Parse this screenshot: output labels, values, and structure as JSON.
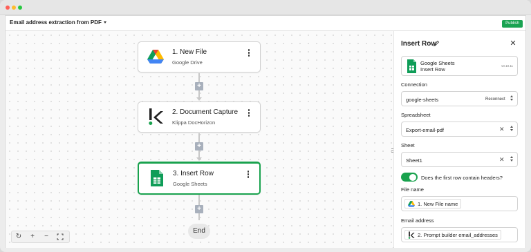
{
  "window": {
    "controls": [
      "close",
      "minimize",
      "maximize"
    ]
  },
  "header": {
    "flow_title": "Email address extraction from PDF",
    "publish_label": "Publish"
  },
  "nodes": [
    {
      "title": "1. New File",
      "subtitle": "Google Drive",
      "icon": "google-drive-icon"
    },
    {
      "title": "2. Document Capture",
      "subtitle": "Klippa DocHorizon",
      "icon": "klippa-icon"
    },
    {
      "title": "3. Insert Row",
      "subtitle": "Google Sheets",
      "icon": "google-sheets-icon",
      "selected": true
    }
  ],
  "end_label": "End",
  "zoom_controls": [
    "refresh",
    "zoom-in",
    "zoom-out",
    "fit-view"
  ],
  "panel": {
    "title": "Insert Row",
    "app_card": {
      "app": "Google Sheets",
      "action": "Insert Row",
      "version": "v0.10.11"
    },
    "connection": {
      "label": "Connection",
      "value": "google-sheets",
      "reconnect": "Reconnect"
    },
    "spreadsheet": {
      "label": "Spreadsheet",
      "value": "Export-email-pdf"
    },
    "sheet": {
      "label": "Sheet",
      "value": "Sheet1"
    },
    "headers_toggle": {
      "label": "Does the first row contain headers?",
      "on": true
    },
    "file_name": {
      "label": "File name",
      "chip": "1. New File name"
    },
    "email_address": {
      "label": "Email address",
      "chip": "2. Prompt builder email_addresses"
    }
  },
  "colors": {
    "accent": "#19a24e",
    "plus_button": "#a8b0bc"
  }
}
